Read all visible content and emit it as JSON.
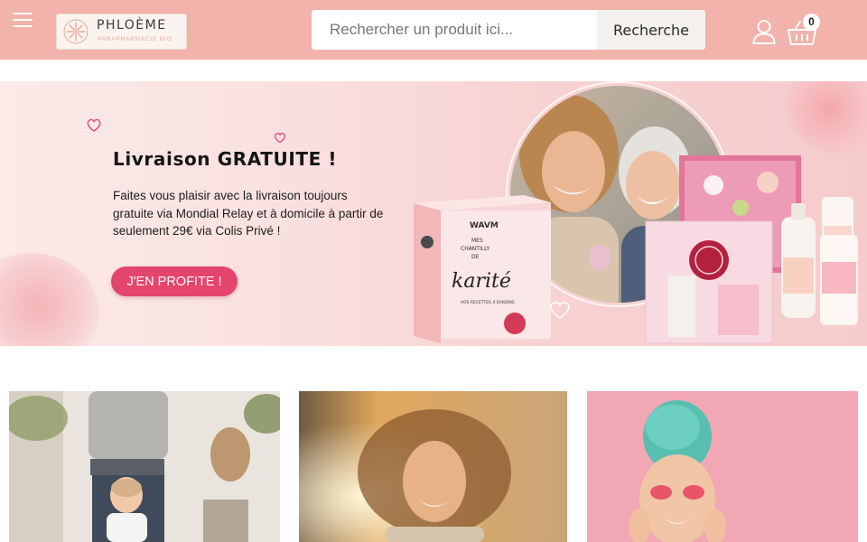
{
  "header": {
    "logo": {
      "name": "PHLOÈME",
      "tagline": "PARAPHARMACIE BIO"
    },
    "search": {
      "placeholder": "Rechercher un produit ici...",
      "button_label": "Recherche"
    },
    "cart": {
      "count": "0"
    },
    "icons": [
      "menu-icon",
      "user-icon",
      "cart-icon"
    ],
    "accent_color": "#f1b3ab"
  },
  "banner": {
    "title": "Livraison GRATUITE !",
    "text": "Faites vous plaisir avec la livraison toujours gratuite via Mondial Relay et à domicile à partir de seulement 29€ via Colis Privé !",
    "cta_label": "J'EN PROFITE !",
    "cta_color": "#e3456d",
    "product_box": {
      "brand": "WAVM",
      "line1": "MES",
      "line2": "CHANTILLY",
      "line3": "DE",
      "script": "karité",
      "bottom": "VOS RECETTES 4 SAISONS"
    }
  },
  "cards": [
    {
      "name": "card-family"
    },
    {
      "name": "card-sunset-woman"
    },
    {
      "name": "card-beauty-mask"
    }
  ]
}
